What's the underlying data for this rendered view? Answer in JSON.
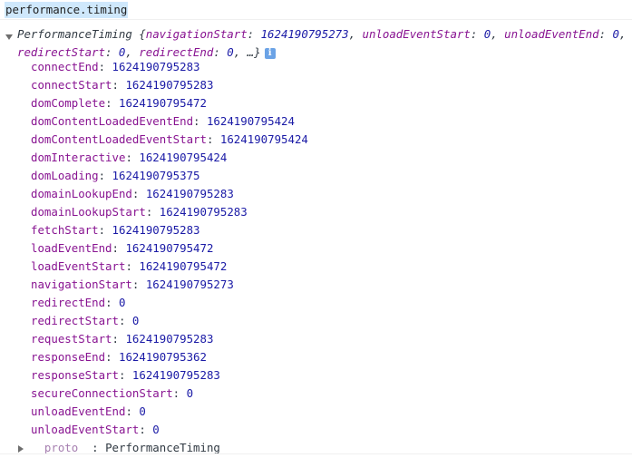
{
  "console": {
    "input": "performance.timing",
    "summary": {
      "type_name": "PerformanceTiming",
      "preview_parts": [
        {
          "key": "navigationStart",
          "value": "1624190795273"
        },
        {
          "key": "unloadEventStart",
          "value": "0"
        },
        {
          "key": "unloadEventEnd",
          "value": "0"
        },
        {
          "key": "redirectStart",
          "value": "0"
        },
        {
          "key": "redirectEnd",
          "value": "0"
        }
      ],
      "ellipsis": "…",
      "info_icon": "info-icon"
    },
    "properties": [
      {
        "name": "connectEnd",
        "value": "1624190795283"
      },
      {
        "name": "connectStart",
        "value": "1624190795283"
      },
      {
        "name": "domComplete",
        "value": "1624190795472"
      },
      {
        "name": "domContentLoadedEventEnd",
        "value": "1624190795424"
      },
      {
        "name": "domContentLoadedEventStart",
        "value": "1624190795424"
      },
      {
        "name": "domInteractive",
        "value": "1624190795424"
      },
      {
        "name": "domLoading",
        "value": "1624190795375"
      },
      {
        "name": "domainLookupEnd",
        "value": "1624190795283"
      },
      {
        "name": "domainLookupStart",
        "value": "1624190795283"
      },
      {
        "name": "fetchStart",
        "value": "1624190795283"
      },
      {
        "name": "loadEventEnd",
        "value": "1624190795472"
      },
      {
        "name": "loadEventStart",
        "value": "1624190795472"
      },
      {
        "name": "navigationStart",
        "value": "1624190795273"
      },
      {
        "name": "redirectEnd",
        "value": "0"
      },
      {
        "name": "redirectStart",
        "value": "0"
      },
      {
        "name": "requestStart",
        "value": "1624190795283"
      },
      {
        "name": "responseEnd",
        "value": "1624190795362"
      },
      {
        "name": "responseStart",
        "value": "1624190795283"
      },
      {
        "name": "secureConnectionStart",
        "value": "0"
      },
      {
        "name": "unloadEventEnd",
        "value": "0"
      },
      {
        "name": "unloadEventStart",
        "value": "0"
      }
    ],
    "proto": {
      "name": "__proto__",
      "value": "PerformanceTiming"
    },
    "colors": {
      "property_name": "#881391",
      "number_value": "#1a1aa6",
      "input_highlight": "#cfe8fc",
      "info_icon": "#6ba3e6"
    }
  }
}
